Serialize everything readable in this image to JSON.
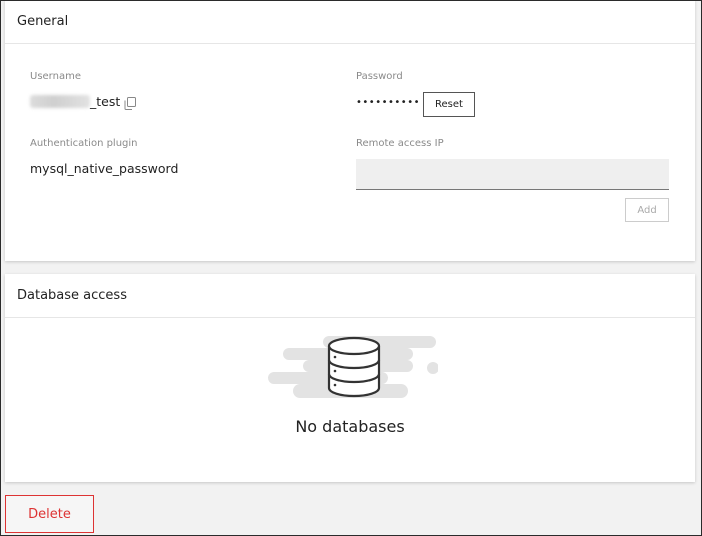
{
  "general": {
    "title": "General",
    "username": {
      "label": "Username",
      "value_suffix": "_test"
    },
    "password": {
      "label": "Password",
      "masked_value": "••••••••••",
      "reset_label": "Reset"
    },
    "auth_plugin": {
      "label": "Authentication plugin",
      "value": "mysql_native_password"
    },
    "remote_access": {
      "label": "Remote access IP",
      "value": "",
      "placeholder": "",
      "add_label": "Add"
    }
  },
  "database_access": {
    "title": "Database access",
    "empty_icon": "database-icon",
    "empty_text": "No databases"
  },
  "actions": {
    "delete_label": "Delete"
  },
  "colors": {
    "danger": "#dd3333",
    "input_bg": "#efefef",
    "page_bg": "#f2f2f2"
  }
}
